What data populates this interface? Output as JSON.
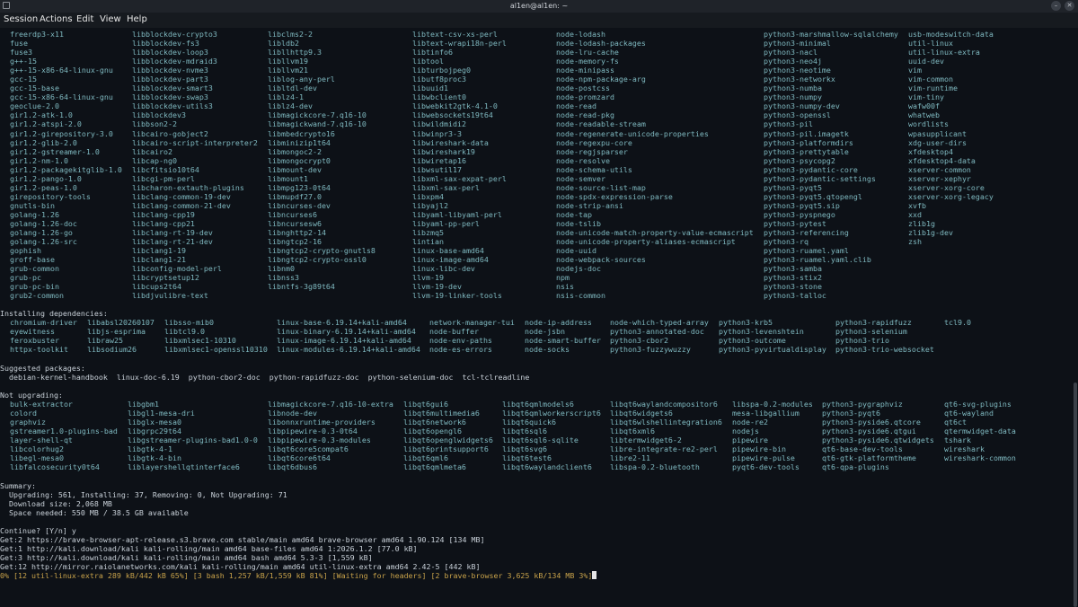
{
  "window": {
    "title": "al1en@al1en: ~",
    "minimize_glyph": "–",
    "close_glyph": "✕"
  },
  "menu": [
    "Session",
    "Actions",
    "Edit",
    "View",
    "Help"
  ],
  "upgrade_columns": [
    [
      "freerdp3-x11",
      "fuse",
      "fuse3",
      "g++-15",
      "g++-15-x86-64-linux-gnu",
      "gcc-15",
      "gcc-15-base",
      "gcc-15-x86-64-linux-gnu",
      "geoclue-2.0",
      "gir1.2-atk-1.0",
      "gir1.2-atspi-2.0",
      "gir1.2-girepository-3.0",
      "gir1.2-glib-2.0",
      "gir1.2-gstreamer-1.0",
      "gir1.2-nm-1.0",
      "gir1.2-packagekitglib-1.0",
      "gir1.2-pango-1.0",
      "gir1.2-peas-1.0",
      "girepository-tools",
      "gnutls-bin",
      "golang-1.26",
      "golang-1.26-doc",
      "golang-1.26-go",
      "golang-1.26-src",
      "gophish",
      "groff-base",
      "grub-common",
      "grub-pc",
      "grub-pc-bin",
      "grub2-common"
    ],
    [
      "libblockdev-crypto3",
      "libblockdev-fs3",
      "libblockdev-loop3",
      "libblockdev-mdraid3",
      "libblockdev-nvme3",
      "libblockdev-part3",
      "libblockdev-smart3",
      "libblockdev-swap3",
      "libblockdev-utils3",
      "libblockdev3",
      "libbson2-2",
      "libcairo-gobject2",
      "libcairo-script-interpreter2",
      "libcairo2",
      "libcap-ng0",
      "libcfitsio10t64",
      "libcgi-pm-perl",
      "libcharon-extauth-plugins",
      "libclang-common-19-dev",
      "libclang-common-21-dev",
      "libclang-cpp19",
      "libclang-cpp21",
      "libclang-rt-19-dev",
      "libclang-rt-21-dev",
      "libclang1-19",
      "libclang1-21",
      "libconfig-model-perl",
      "libcryptsetup12",
      "libcups2t64",
      "libdjvulibre-text"
    ],
    [
      "libclms2-2",
      "libldb2",
      "libllhttp9.3",
      "libllvm19",
      "libllvm21",
      "liblog-any-perl",
      "libltdl-dev",
      "liblz4-1",
      "liblz4-dev",
      "libmagickcore-7.q16-10",
      "libmagickwand-7.q16-10",
      "libmbedcrypto16",
      "libminizip1t64",
      "libmongoc2-2",
      "libmongocrypt0",
      "libmount-dev",
      "libmount1",
      "libmpg123-0t64",
      "libmupdf27.0",
      "libncurses-dev",
      "libncurses6",
      "libncursesw6",
      "libnghttp2-14",
      "libngtcp2-16",
      "libngtcp2-crypto-gnutls8",
      "libngtcp2-crypto-ossl0",
      "libnm0",
      "libnss3",
      "libntfs-3g89t64"
    ],
    [
      "libtext-csv-xs-perl",
      "libtext-wrapi18n-perl",
      "libtinfo6",
      "libtool",
      "libturbojpeg0",
      "libutf8proc3",
      "libuuid1",
      "libwbclient0",
      "libwebkit2gtk-4.1-0",
      "libwebsockets19t64",
      "libwildmidi2",
      "libwinpr3-3",
      "libwireshark-data",
      "libwireshark19",
      "libwiretap16",
      "libwsutil17",
      "libxml-sax-expat-perl",
      "libxml-sax-perl",
      "libxpm4",
      "libyajl2",
      "libyaml-libyaml-perl",
      "libyaml-pp-perl",
      "libzmq5",
      "lintian",
      "linux-base-amd64",
      "linux-image-amd64",
      "linux-libc-dev",
      "llvm-19",
      "llvm-19-dev",
      "llvm-19-linker-tools"
    ],
    [
      "node-lodash",
      "node-lodash-packages",
      "node-lru-cache",
      "node-memory-fs",
      "node-minipass",
      "node-npm-package-arg",
      "node-postcss",
      "node-promzard",
      "node-read",
      "node-read-pkg",
      "node-readable-stream",
      "node-regenerate-unicode-properties",
      "node-regexpu-core",
      "node-regjsparser",
      "node-resolve",
      "node-schema-utils",
      "node-semver",
      "node-source-list-map",
      "node-spdx-expression-parse",
      "node-strip-ansi",
      "node-tap",
      "node-tslib",
      "node-unicode-match-property-value-ecmascript",
      "node-unicode-property-aliases-ecmascript",
      "node-uuid",
      "node-webpack-sources",
      "nodejs-doc",
      "npm",
      "nsis",
      "nsis-common"
    ],
    [
      "python3-marshmallow-sqlalchemy",
      "python3-minimal",
      "python3-nacl",
      "python3-neo4j",
      "python3-neotime",
      "python3-networkx",
      "python3-numba",
      "python3-numpy",
      "python3-numpy-dev",
      "python3-openssl",
      "python3-pil",
      "python3-pil.imagetk",
      "python3-platformdirs",
      "python3-prettytable",
      "python3-psycopg2",
      "python3-pydantic-core",
      "python3-pydantic-settings",
      "python3-pyqt5",
      "python3-pyqt5.qtopengl",
      "python3-pyqt5.sip",
      "python3-pyspnego",
      "python3-pytest",
      "python3-referencing",
      "python3-rq",
      "python3-ruamel.yaml",
      "python3-ruamel.yaml.clib",
      "python3-samba",
      "python3-stix2",
      "python3-stone",
      "python3-talloc"
    ],
    [
      "usb-modeswitch-data",
      "util-linux",
      "util-linux-extra",
      "uuid-dev",
      "vim",
      "vim-common",
      "vim-runtime",
      "vim-tiny",
      "wafw00f",
      "whatweb",
      "wordlists",
      "wpasupplicant",
      "xdg-user-dirs",
      "xfdesktop4",
      "xfdesktop4-data",
      "xserver-common",
      "xserver-xephyr",
      "xserver-xorg-core",
      "xserver-xorg-legacy",
      "xvfb",
      "xxd",
      "zlib1g",
      "zlib1g-dev",
      "zsh"
    ]
  ],
  "installing": {
    "heading": "Installing dependencies:",
    "columns": [
      [
        "chromium-driver",
        "eyewitness",
        "feroxbuster",
        "httpx-toolkit"
      ],
      [
        "libabsl20260107",
        "libjs-esprima",
        "libraw25",
        "libsodium26"
      ],
      [
        "libsso-mib0",
        "libtcl9.0",
        "libxmlsec1-10310",
        "libxmlsec1-openssl10310"
      ],
      [
        "linux-base-6.19.14+kali-amd64",
        "linux-binary-6.19.14+kali-amd64",
        "linux-image-6.19.14+kali-amd64",
        "linux-modules-6.19.14+kali-amd64"
      ],
      [
        "network-manager-tui",
        "node-buffer",
        "node-env-paths",
        "node-es-errors"
      ],
      [
        "node-ip-address",
        "node-jsbn",
        "node-smart-buffer",
        "node-socks"
      ],
      [
        "node-which-typed-array",
        "python3-annotated-doc",
        "python3-cbor2",
        "python3-fuzzywuzzy"
      ],
      [
        "python3-krb5",
        "python3-levenshtein",
        "python3-outcome",
        "python3-pyvirtualdisplay"
      ],
      [
        "python3-rapidfuzz",
        "python3-selenium",
        "python3-trio",
        "python3-trio-websocket"
      ],
      [
        "tcl9.0"
      ]
    ]
  },
  "suggested": {
    "heading": "Suggested packages:",
    "line": "  debian-kernel-handbook  linux-doc-6.19  python-cbor2-doc  python-rapidfuzz-doc  python-selenium-doc  tcl-tclreadline"
  },
  "not_upgrading": {
    "heading": "Not upgrading:",
    "columns": [
      [
        "bulk-extractor",
        "colord",
        "graphviz",
        "gstreamer1.0-plugins-bad",
        "layer-shell-qt",
        "libcolorhug2",
        "libegl-mesa0",
        "libfalcosecurity0t64"
      ],
      [
        "libgbm1",
        "libgl1-mesa-dri",
        "libglx-mesa0",
        "libgrpc29t64",
        "libgstreamer-plugins-bad1.0-0",
        "libgtk-4-1",
        "libgtk-4-bin",
        "liblayershellqtinterface6"
      ],
      [
        "libmagickcore-7.q16-10-extra",
        "libnode-dev",
        "libonnxruntime-providers",
        "libpipewire-0.3-0t64",
        "libpipewire-0.3-modules",
        "libqt6core5compat6",
        "libqt6core6t64",
        "libqt6dbus6"
      ],
      [
        "libqt6gui6",
        "libqt6multimedia6",
        "libqt6network6",
        "libqt6opengl6",
        "libqt6openglwidgets6",
        "libqt6printsupport6",
        "libqt6qml6",
        "libqt6qmlmeta6"
      ],
      [
        "libqt6qmlmodels6",
        "libqt6qmlworkerscript6",
        "libqt6quick6",
        "libqt6sql6",
        "libqt6sql6-sqlite",
        "libqt6svg6",
        "libqt6test6",
        "libqt6waylandclient6"
      ],
      [
        "libqt6waylandcompositor6",
        "libqt6widgets6",
        "libqt6wlshellintegration6",
        "libqt6xml6",
        "libtermwidget6-2",
        "libre-integrate-re2-perl",
        "libre2-11",
        "libspa-0.2-bluetooth"
      ],
      [
        "libspa-0.2-modules",
        "mesa-libgallium",
        "node-re2",
        "nodejs",
        "pipewire",
        "pipewire-bin",
        "pipewire-pulse",
        "pyqt6-dev-tools"
      ],
      [
        "python3-pygraphviz",
        "python3-pyqt6",
        "python3-pyside6.qtcore",
        "python3-pyside6.qtgui",
        "python3-pyside6.qtwidgets",
        "qt6-base-dev-tools",
        "qt6-gtk-platformtheme",
        "qt6-qpa-plugins"
      ],
      [
        "qt6-svg-plugins",
        "qt6-wayland",
        "qt6ct",
        "qtermwidget-data",
        "tshark",
        "wireshark",
        "wireshark-common"
      ]
    ]
  },
  "summary": {
    "heading": "Summary:",
    "lines": [
      "  Upgrading: 561, Installing: 37, Removing: 0, Not Upgrading: 71",
      "  Download size: 2,068 MB",
      "  Space needed: 550 MB / 38.5 GB available"
    ]
  },
  "prompt": "Continue? [Y/n] y",
  "get_lines": [
    "Get:2 https://brave-browser-apt-release.s3.brave.com stable/main amd64 brave-browser amd64 1.90.124 [134 MB]",
    "Get:1 http://kali.download/kali kali-rolling/main amd64 base-files amd64 1:2026.1.2 [77.0 kB]",
    "Get:3 http://kali.download/kali kali-rolling/main amd64 bash amd64 5.3-3 [1,559 kB]",
    "Get:12 http://mirror.raiolanetworks.com/kali kali-rolling/main amd64 util-linux-extra amd64 2.42-5 [442 kB]"
  ],
  "progress_line": "0% [12 util-linux-extra 289 kB/442 kB 65%] [3 bash 1,257 kB/1,559 kB 81%] [Waiting for headers] [2 brave-browser 3,625 kB/134 MB 3%]"
}
